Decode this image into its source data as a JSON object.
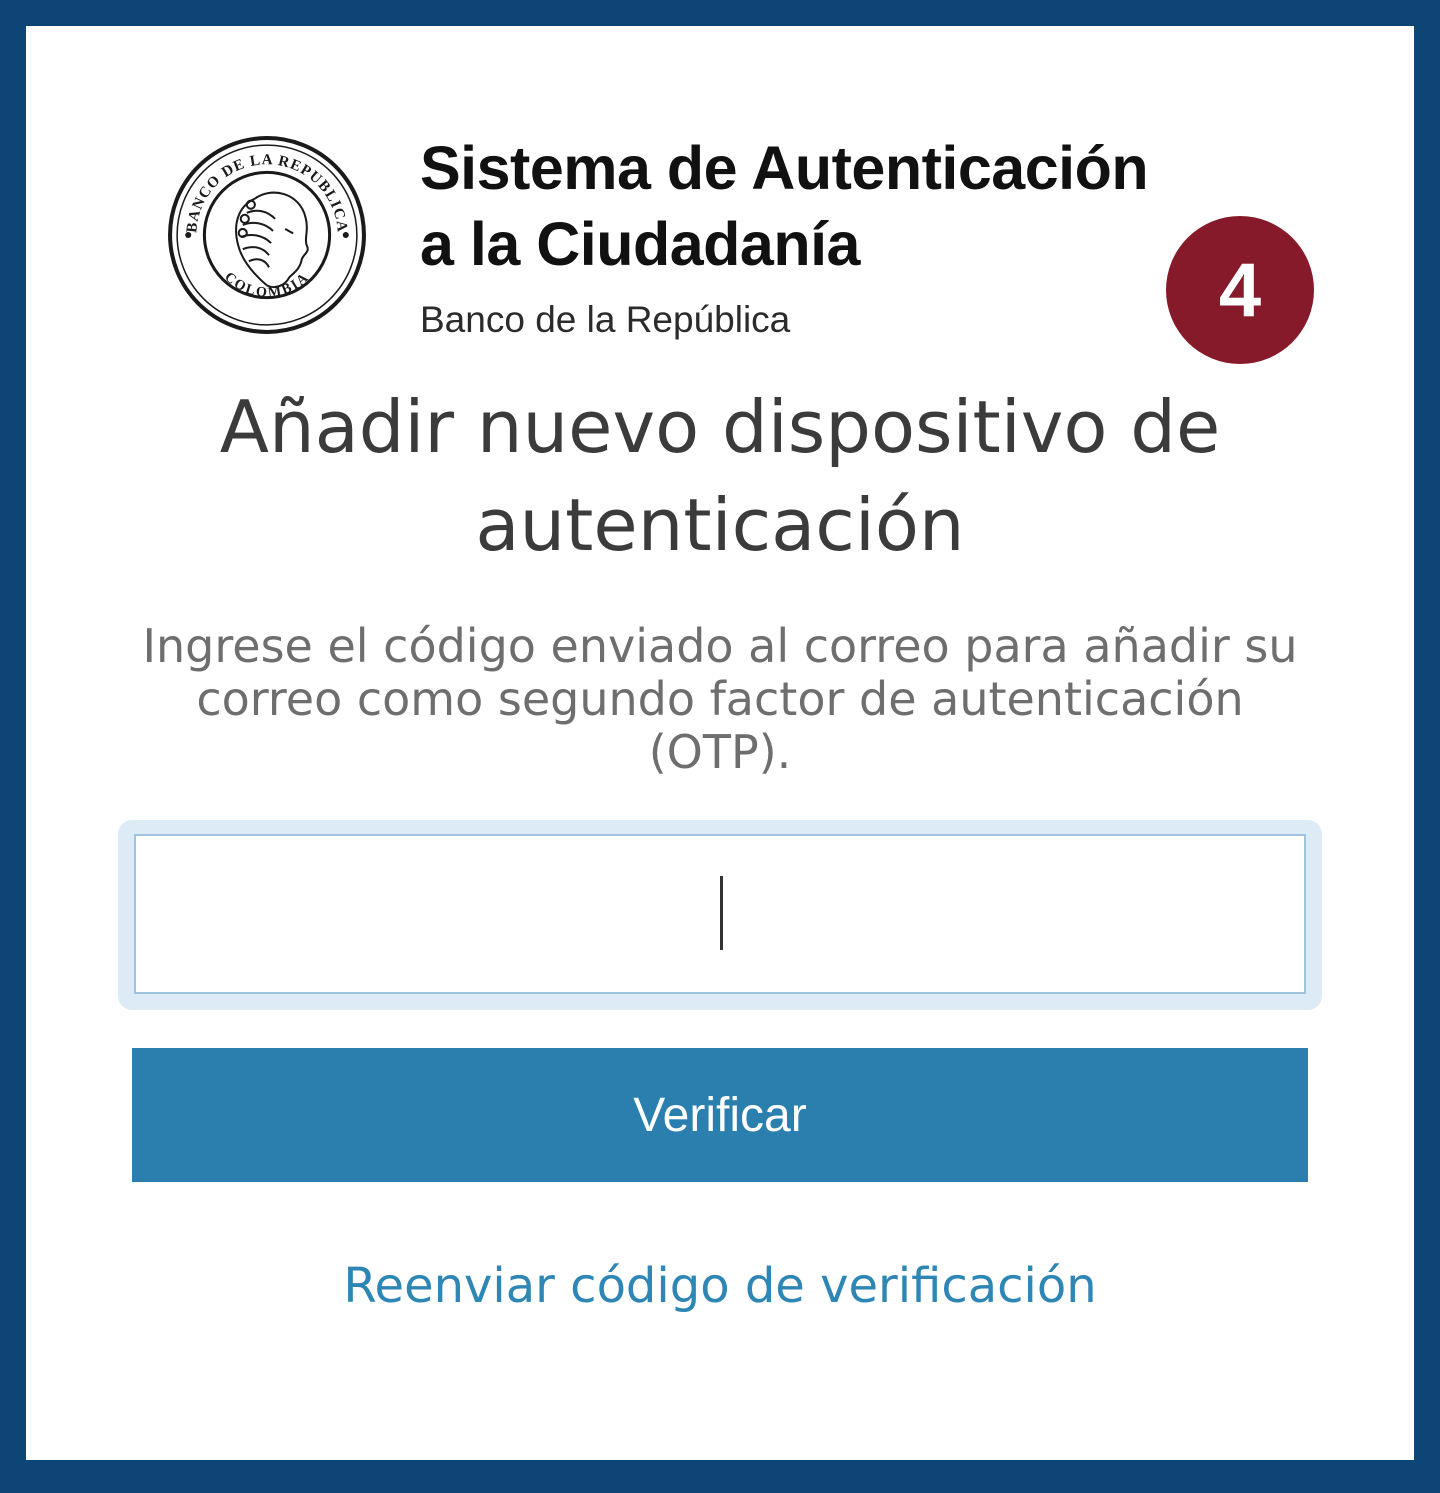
{
  "brand": {
    "title_line1": "Sistema de Autenticación",
    "title_line2": "a la Ciudadanía",
    "subtitle": "Banco de la República",
    "logo_icon": "banco-de-la-republica-seal-icon",
    "seal_text_top": "BANCO DE LA REPUBLICA",
    "seal_text_bottom": "COLOMBIA"
  },
  "step_badge": {
    "number": "4",
    "color": "#861a2b"
  },
  "main": {
    "title": "Añadir nuevo dispositivo de autenticación",
    "instructions": "Ingrese el código enviado al correo para añadir su correo como segundo factor de autenticación (OTP).",
    "otp_input": {
      "value": "",
      "placeholder": ""
    },
    "verify_button_label": "Verificar",
    "resend_link_label": "Reenviar código de verificación"
  },
  "colors": {
    "page_background": "#0e4577",
    "card_background": "#ffffff",
    "button": "#2a7fae",
    "link": "#2e86b5"
  }
}
